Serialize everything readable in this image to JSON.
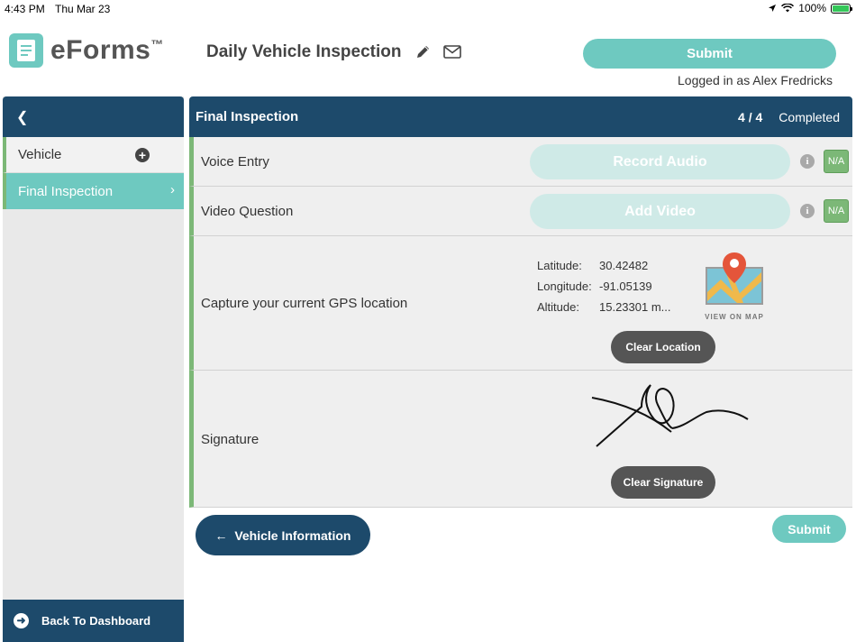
{
  "status": {
    "time": "4:43 PM",
    "date": "Thu Mar 23",
    "battery": "100%"
  },
  "app": {
    "name": "eForms",
    "trademark": "™"
  },
  "form": {
    "title": "Daily Vehicle Inspection"
  },
  "header": {
    "submit_label": "Submit",
    "logged_in": "Logged in as Alex Fredricks"
  },
  "sidebar": {
    "items": [
      {
        "label": "Vehicle"
      },
      {
        "label": "Final Inspection"
      }
    ],
    "footer_label": "Back To Dashboard"
  },
  "section": {
    "title": "Final Inspection",
    "progress": "4 / 4",
    "status": "Completed"
  },
  "questions": {
    "voice": {
      "label": "Voice Entry",
      "button": "Record Audio",
      "na": "N/A"
    },
    "video": {
      "label": "Video Question",
      "button": "Add Video",
      "na": "N/A"
    },
    "gps": {
      "label": "Capture your current GPS location",
      "latitude_key": "Latitude:",
      "latitude": "30.42482",
      "longitude_key": "Longitude:",
      "longitude": "-91.05139",
      "altitude_key": "Altitude:",
      "altitude": "15.23301 m...",
      "map_caption": "VIEW ON MAP",
      "clear_label": "Clear Location"
    },
    "signature": {
      "label": "Signature",
      "clear_label": "Clear Signature"
    }
  },
  "footer": {
    "back_label": "Vehicle Information",
    "submit_label": "Submit"
  },
  "colors": {
    "navy": "#1d4a6b",
    "teal": "#6ec9c0",
    "green": "#7cb877",
    "dark_button": "#555555"
  }
}
